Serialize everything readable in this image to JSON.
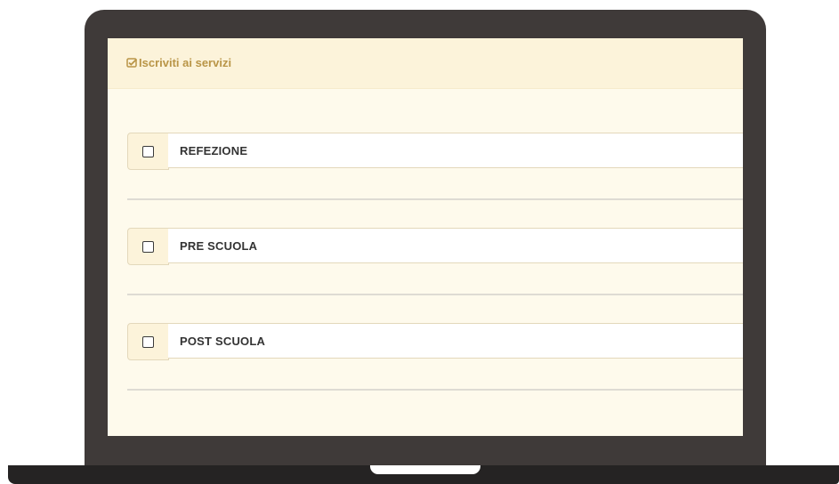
{
  "panel": {
    "title": "Iscriviti ai servizi",
    "title_icon": "check-square-icon"
  },
  "services": [
    {
      "label": "REFEZIONE",
      "checked": false
    },
    {
      "label": "PRE SCUOLA",
      "checked": false
    },
    {
      "label": "POST SCUOLA",
      "checked": false
    }
  ],
  "colors": {
    "accent": "#b99547",
    "header_bg": "#fcf3da",
    "screen_bg": "#fefaec",
    "laptop_frame": "#3f3a39"
  }
}
